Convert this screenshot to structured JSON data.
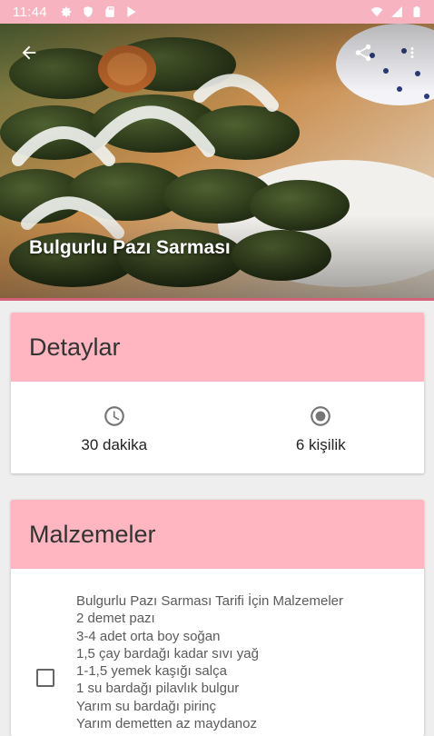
{
  "status_bar": {
    "time": "11:44",
    "left_icons": [
      "gear-icon",
      "shield-icon",
      "sd-card-icon",
      "play-store-icon"
    ],
    "right_icons": [
      "wifi-icon",
      "signal-icon",
      "battery-icon"
    ]
  },
  "hero": {
    "title": "Bulgurlu Pazı Sarması",
    "back_icon": "arrow-back-icon",
    "share_icon": "share-icon",
    "more_icon": "more-vert-icon"
  },
  "details": {
    "header": "Detaylar",
    "duration": "30 dakika",
    "servings": "6 kişilik",
    "duration_icon": "clock-icon",
    "servings_icon": "radio-button-icon"
  },
  "ingredients": {
    "header": "Malzemeler",
    "checked": false,
    "items": [
      "Bulgurlu Pazı Sarması Tarifi İçin Malzemeler",
      "2 demet pazı",
      "3-4 adet orta boy soğan",
      "1,5 çay bardağı kadar sıvı yağ",
      "1-1,5 yemek kaşığı salça",
      "1 su bardağı pilavlık bulgur",
      "Yarım su bardağı pirinç",
      "Yarım demetten az maydanoz"
    ]
  },
  "colors": {
    "status_bar": "#f7b3c0",
    "card_header": "#ffb6c1",
    "divider": "#d4607a",
    "background": "#eeeeee"
  }
}
